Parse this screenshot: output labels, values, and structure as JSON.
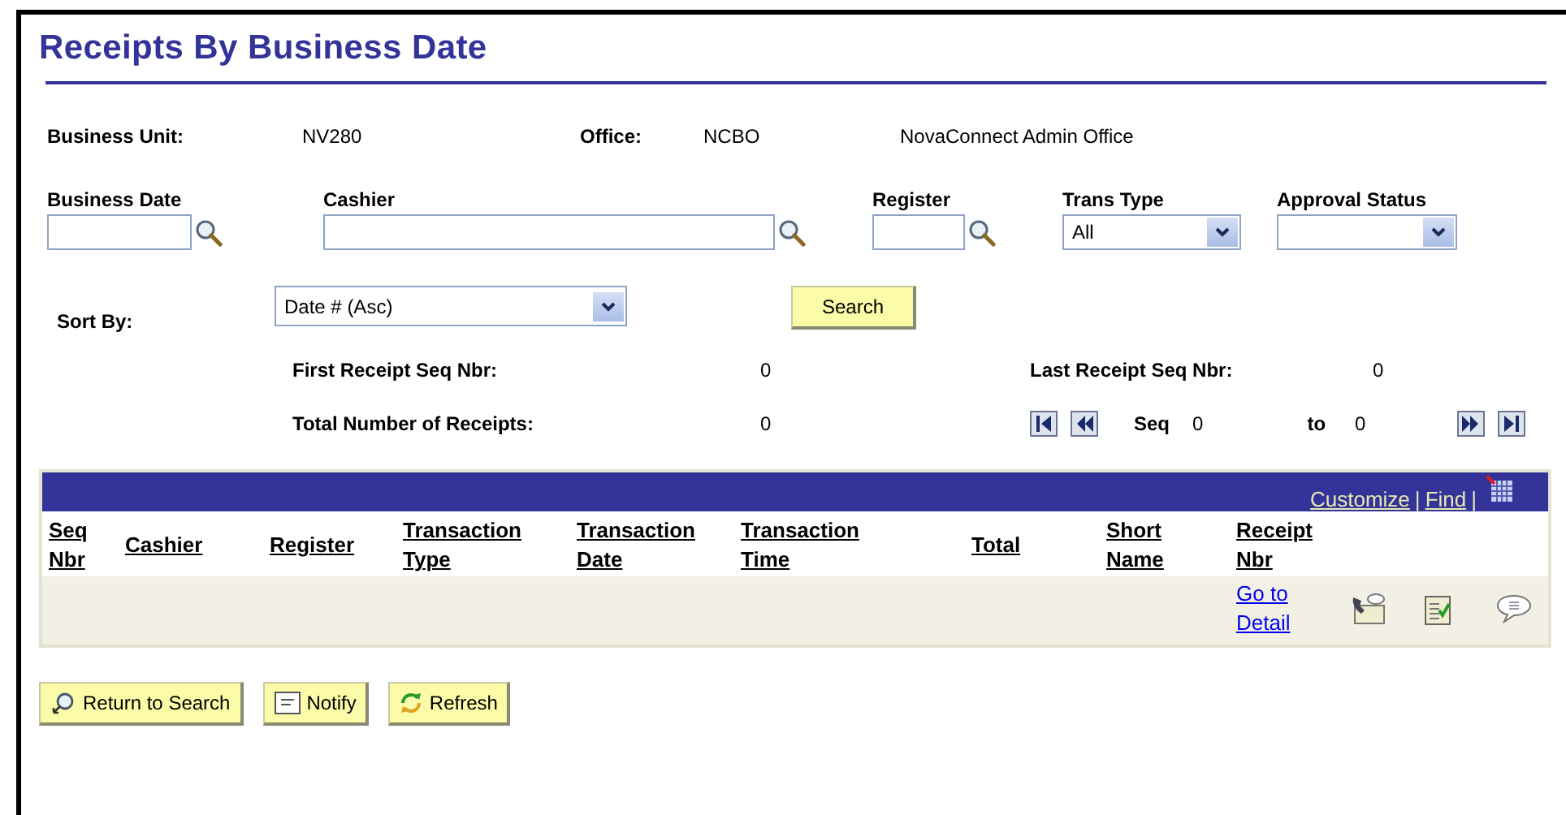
{
  "title": "Receipts By Business Date",
  "business_unit": {
    "label": "Business Unit:",
    "value": "NV280"
  },
  "office": {
    "label": "Office:",
    "code": "NCBO",
    "name": "NovaConnect Admin Office"
  },
  "filters": [
    {
      "label": "Business Date",
      "kind": "lookup"
    },
    {
      "label": "Cashier",
      "kind": "lookup"
    },
    {
      "label": "Register",
      "kind": "lookup"
    },
    {
      "label": "Trans Type",
      "kind": "select",
      "value": "All"
    },
    {
      "label": "Approval Status",
      "kind": "select"
    }
  ],
  "sort_by": {
    "label": "Sort By:",
    "value": "Date # (Asc)"
  },
  "search_button": "Search",
  "stats": {
    "first_label": "First Receipt Seq Nbr:",
    "first_value": "0",
    "last_label": "Last Receipt Seq Nbr:",
    "last_value": "0",
    "total_label": "Total Number of Receipts:",
    "total_value": "0"
  },
  "pager": {
    "seq_label": "Seq",
    "from": "0",
    "to_label": "to",
    "to": "0"
  },
  "grid": {
    "links": [
      "Customize",
      "Find"
    ],
    "separator": "|",
    "columns": [
      [
        "Seq",
        "Nbr"
      ],
      [
        "Cashier"
      ],
      [
        "Register"
      ],
      [
        "Transaction",
        "Type"
      ],
      [
        "Transaction",
        "Date"
      ],
      [
        "Transaction",
        "Time"
      ],
      [
        "Total"
      ],
      [
        "Short",
        "Name"
      ],
      [
        "Receipt",
        "Nbr"
      ]
    ],
    "row": {
      "detail_link": "Go to Detail"
    }
  },
  "buttons": [
    {
      "label": "Return to Search",
      "kind": "return"
    },
    {
      "label": "Notify",
      "kind": "notify"
    },
    {
      "label": "Refresh",
      "kind": "refresh"
    }
  ]
}
